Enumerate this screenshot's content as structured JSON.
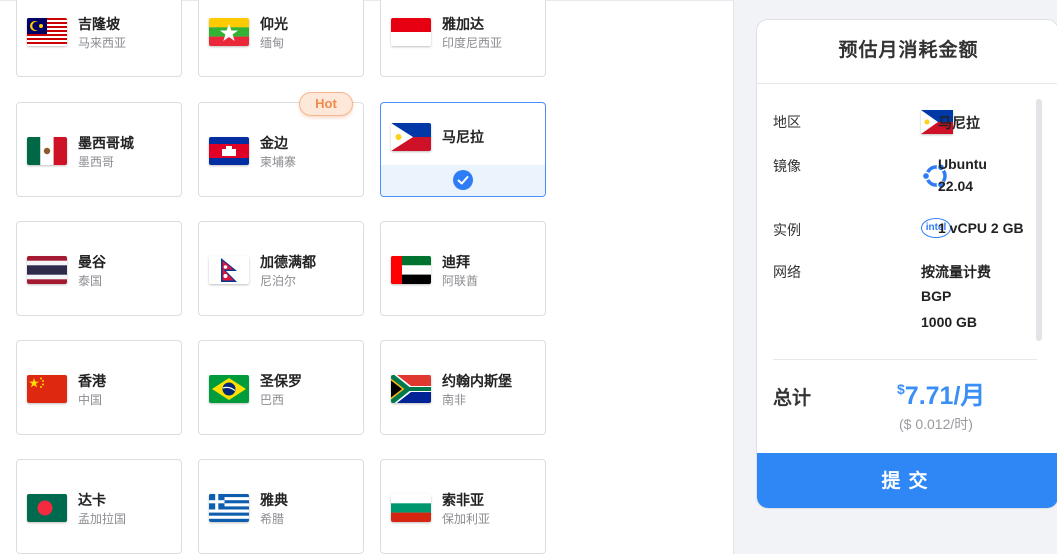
{
  "regions": [
    {
      "name": "吉隆坡",
      "sub": "马来西亚",
      "flag": "malaysia"
    },
    {
      "name": "仰光",
      "sub": "缅甸",
      "flag": "myanmar"
    },
    {
      "name": "雅加达",
      "sub": "印度尼西亚",
      "flag": "indonesia"
    },
    {
      "name": "墨西哥城",
      "sub": "墨西哥",
      "flag": "mexico"
    },
    {
      "name": "金边",
      "sub": "柬埔寨",
      "flag": "cambodia",
      "badge": "Hot"
    },
    {
      "name": "马尼拉",
      "sub": "",
      "flag": "philippines",
      "selected": true
    },
    {
      "name": "曼谷",
      "sub": "泰国",
      "flag": "thailand"
    },
    {
      "name": "加德满都",
      "sub": "尼泊尔",
      "flag": "nepal"
    },
    {
      "name": "迪拜",
      "sub": "阿联酋",
      "flag": "uae"
    },
    {
      "name": "香港",
      "sub": "中国",
      "flag": "china"
    },
    {
      "name": "圣保罗",
      "sub": "巴西",
      "flag": "brazil"
    },
    {
      "name": "约翰内斯堡",
      "sub": "南非",
      "flag": "south-africa"
    },
    {
      "name": "达卡",
      "sub": "孟加拉国",
      "flag": "bangladesh"
    },
    {
      "name": "雅典",
      "sub": "希腊",
      "flag": "greece"
    },
    {
      "name": "索非亚",
      "sub": "保加利亚",
      "flag": "bulgaria"
    }
  ],
  "summary": {
    "title": "预估月消耗金额",
    "region_label": "地区",
    "region_value": "马尼拉",
    "image_label": "镜像",
    "image_name": "Ubuntu",
    "image_version": "22.04",
    "instance_label": "实例",
    "instance_value": "1 vCPU 2 GB",
    "instance_icon_text": "intel",
    "network_label": "网络",
    "network_billing": "按流量计费",
    "network_type": "BGP",
    "network_bandwidth": "1000 GB",
    "total_label": "总计",
    "currency": "$",
    "price": "7.71/月",
    "price_hourly": "($ 0.012/时)",
    "submit_label": "提交"
  },
  "colors": {
    "accent": "#2f86f5",
    "hot": "#ef8a4f"
  }
}
